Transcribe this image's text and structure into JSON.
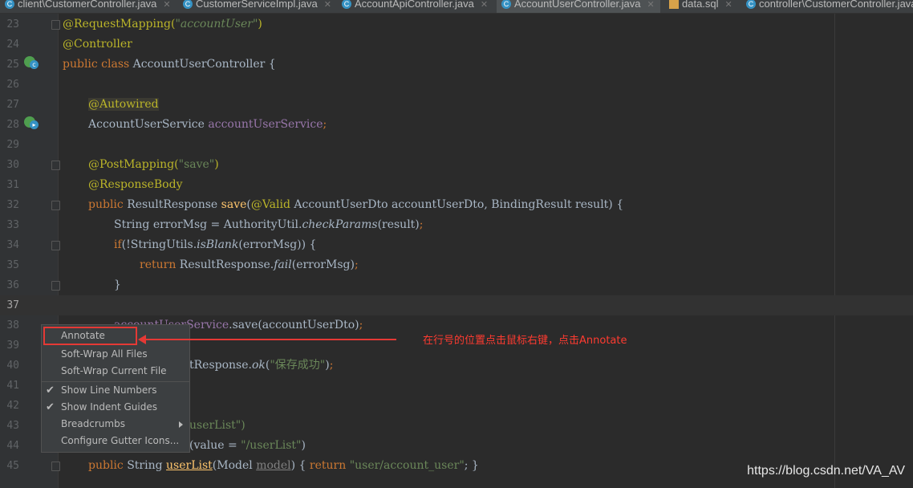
{
  "tabs": [
    {
      "label": "client\\CustomerController.java",
      "type": "java",
      "active": false
    },
    {
      "label": "CustomerServiceImpl.java",
      "type": "java",
      "active": false
    },
    {
      "label": "AccountApiController.java",
      "type": "java",
      "active": false
    },
    {
      "label": "AccountUserController.java",
      "type": "java",
      "active": true
    },
    {
      "label": "data.sql",
      "type": "sql",
      "active": false
    },
    {
      "label": "controller\\CustomerController.java",
      "type": "java",
      "active": false
    }
  ],
  "line_numbers": [
    "23",
    "24",
    "25",
    "26",
    "27",
    "28",
    "29",
    "30",
    "31",
    "32",
    "33",
    "34",
    "35",
    "36",
    "37",
    "38",
    "39",
    "40",
    "41",
    "42",
    "43",
    "44",
    "45"
  ],
  "code": {
    "l23": {
      "a": "@RequestMapping(",
      "b": "\"accountUser\"",
      "c": ")"
    },
    "l24": {
      "a": "@Controller"
    },
    "l25": {
      "a": "public class ",
      "b": "AccountUserController {"
    },
    "l27": {
      "a": "@Autowired"
    },
    "l28": {
      "a": "AccountUserService ",
      "b": "accountUserService",
      "c": ";"
    },
    "l30": {
      "a": "@PostMapping(",
      "b": "\"save\"",
      "c": ")"
    },
    "l31": {
      "a": "@ResponseBody"
    },
    "l32": {
      "a": "public ",
      "b": "ResultResponse ",
      "c": "save",
      "d": "(",
      "e": "@Valid ",
      "f": "AccountUserDto accountUserDto, BindingResult result) {"
    },
    "l33": {
      "a": "String errorMsg = AuthorityUtil.",
      "b": "checkParams",
      "c": "(result)",
      "d": ";"
    },
    "l34": {
      "a": "if",
      "b": "(!StringUtils.",
      "c": "isBlank",
      "d": "(errorMsg)) {"
    },
    "l35": {
      "a": "return ",
      "b": "ResultResponse.",
      "c": "fail",
      "d": "(errorMsg)",
      "e": ";"
    },
    "l36": {
      "a": "}"
    },
    "l38": {
      "a": "accountUserService",
      "b": ".save(accountUserDto)",
      "c": ";"
    },
    "l40": {
      "a": "tResponse.",
      "b": "ok",
      "c": "(",
      "d": "\"保存成功\"",
      "e": ")",
      "f": ";"
    },
    "l43": {
      "a": "userList\")"
    },
    "l44": {
      "a": "(value = ",
      "b": "\"/userList\"",
      "c": ")"
    },
    "l45": {
      "a": "public ",
      "b": "String ",
      "c": "userList",
      "d": "(Model ",
      "e": "model",
      "f": ") { ",
      "g": "return ",
      "h": "\"user/account_user\"",
      "i": "; }"
    }
  },
  "context_menu": {
    "items": [
      {
        "label": "Annotate",
        "checked": false,
        "submenu": false
      },
      {
        "label": "Soft-Wrap All Files",
        "checked": false,
        "submenu": false
      },
      {
        "label": "Soft-Wrap Current File",
        "checked": false,
        "submenu": false
      },
      {
        "label": "Show Line Numbers",
        "checked": true,
        "submenu": false
      },
      {
        "label": "Show Indent Guides",
        "checked": true,
        "submenu": false
      },
      {
        "label": "Breadcrumbs",
        "checked": false,
        "submenu": true
      },
      {
        "label": "Configure Gutter Icons...",
        "checked": false,
        "submenu": false
      }
    ],
    "check_glyph": "✔"
  },
  "annotation": {
    "text": "在行号的位置点击鼠标右键，点击Annotate",
    "color": "#ff3b30"
  },
  "watermark": "https://blog.csdn.net/VA_AV",
  "icons": {
    "java_file": "c-icon",
    "sql_file": "sql-icon",
    "gutter_bean": "spring-bean-icon"
  },
  "colors": {
    "background": "#2b2b2b",
    "annotation": "#bbb529",
    "keyword": "#cc7832",
    "string": "#6a8759",
    "field": "#9876aa",
    "method": "#ffc66d",
    "highlight": "#e53935"
  }
}
